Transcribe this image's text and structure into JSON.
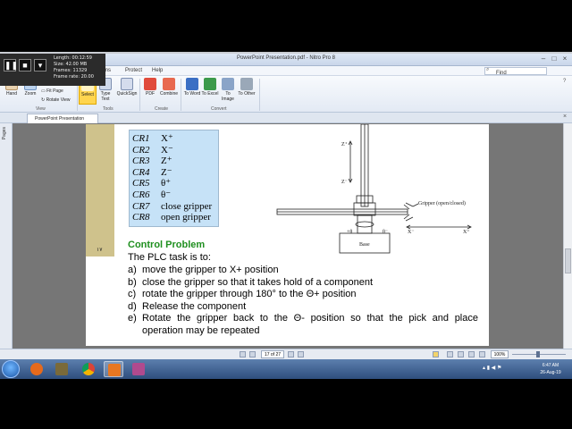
{
  "recorder": {
    "length": "Length: 00:12:59",
    "size": "Size: 42.00 MB",
    "frames": "Frames: 11329",
    "frame_rate": "Frame rate: 20.00"
  },
  "window": {
    "title": "PowerPoint Presentation.pdf - Nitro Pro 8"
  },
  "menu": {
    "protect": "Protect",
    "help": "Help",
    "ms": "ms",
    "search_placeholder": "Find"
  },
  "ribbon": {
    "hand": "Hand",
    "zoom": "Zoom",
    "fit_page": "Fit Page",
    "rotate_view": "Rotate View",
    "select": "Select",
    "type_text": "Type Text",
    "quicksign": "QuickSign",
    "pdf": "PDF",
    "combine": "Combine",
    "to_word": "To Word",
    "to_excel": "To Excel",
    "to_image": "To Image",
    "to_other": "To Other",
    "groups": {
      "view": "View",
      "tools": "Tools",
      "create": "Create",
      "convert": "Convert"
    }
  },
  "tabs": {
    "doc_tab": "PowerPoint Presentation"
  },
  "left_pane": {
    "label": "Pages"
  },
  "slide": {
    "number": "١٧",
    "cr_rows": [
      {
        "cr": "CR1",
        "act": "X⁺"
      },
      {
        "cr": "CR2",
        "act": "X⁻"
      },
      {
        "cr": "CR3",
        "act": "Z⁺"
      },
      {
        "cr": "CR4",
        "act": "Z⁻"
      },
      {
        "cr": "CR5",
        "act": "θ⁺"
      },
      {
        "cr": "CR6",
        "act": "θ⁻"
      },
      {
        "cr": "CR7",
        "act": "close gripper"
      },
      {
        "cr": "CR8",
        "act": "open gripper"
      }
    ],
    "control_title": "Control Problem",
    "intro": "The PLC task is to:",
    "steps": [
      {
        "label": "a)",
        "text": "move the gripper to X+ position"
      },
      {
        "label": "b)",
        "text": "close the gripper so that it takes hold of a component"
      },
      {
        "label": "c)",
        "text": "rotate the gripper through 180° to the Θ+ position"
      },
      {
        "label": "d)",
        "text": "Release the component"
      },
      {
        "label": "e)",
        "text": "Rotate the gripper back to the Θ- position so that the pick and place"
      },
      {
        "label": "",
        "text": "operation may be repeated"
      }
    ],
    "diagram": {
      "z_plus": "Z⁺",
      "z_minus": "Z⁻",
      "gripper_label": "Gripper (open/closed)",
      "theta_plus": "+θ",
      "theta_minus": "θ⁻",
      "x_minus": "X⁻",
      "x_plus": "X⁺",
      "base": "Base"
    }
  },
  "status": {
    "page": "17 of 27",
    "zoom": "100%"
  },
  "taskbar": {
    "time": "6:47 AM",
    "date": "26-Aug-19"
  },
  "colors": {
    "cr_box": "#c6e2f7",
    "control_title": "#1f8f1f",
    "strip": "#cfc28c"
  }
}
